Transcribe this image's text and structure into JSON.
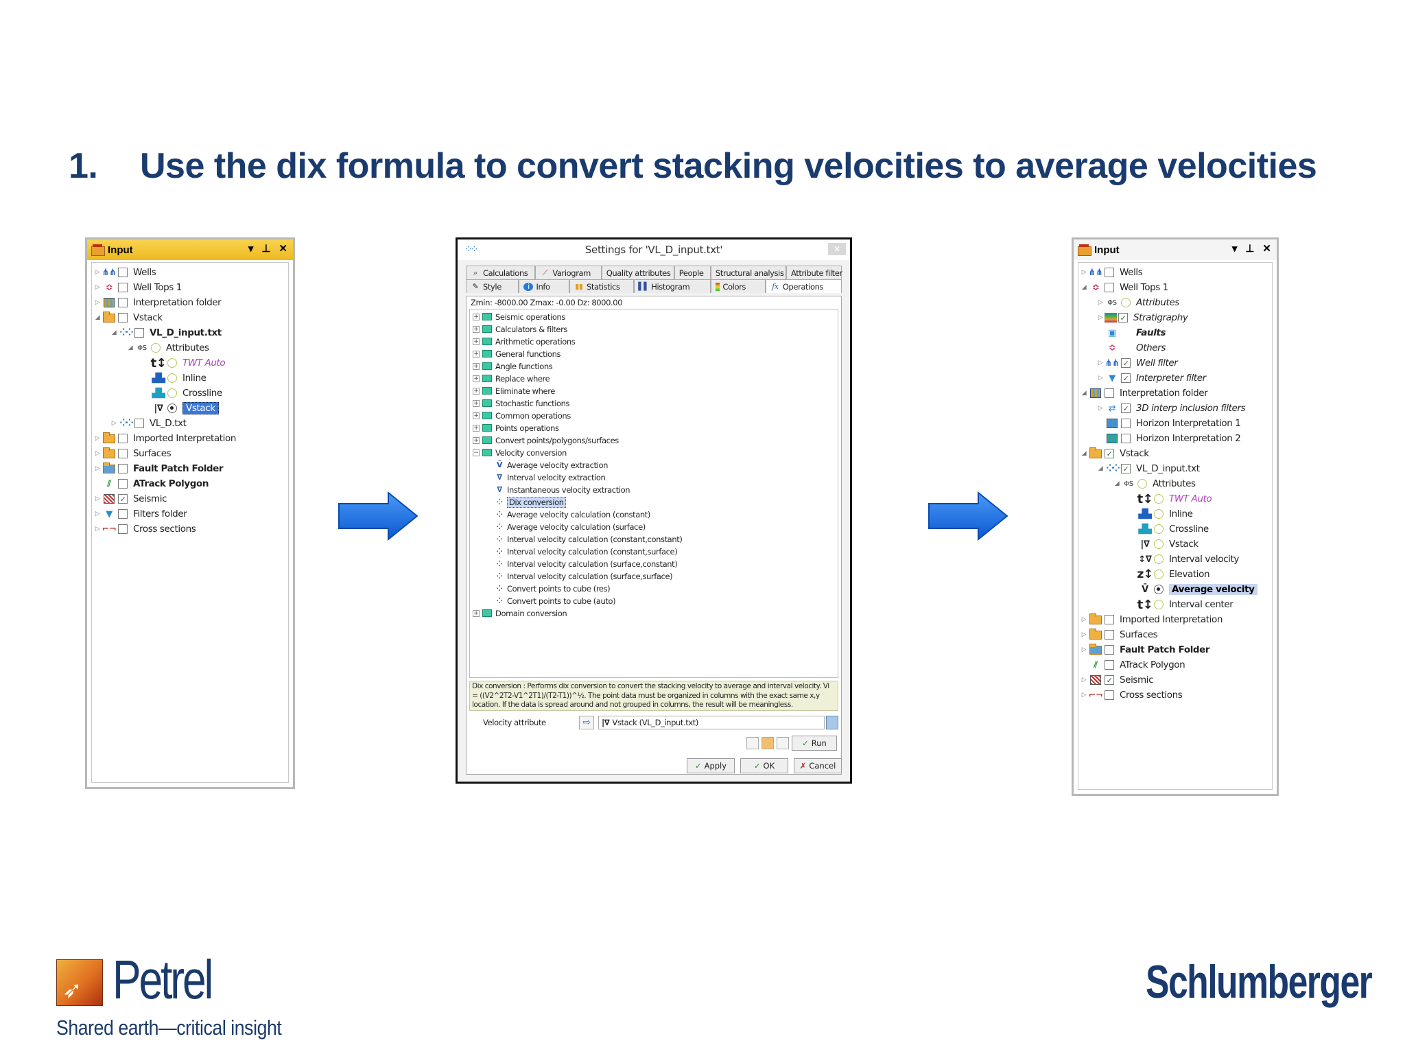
{
  "slide": {
    "number": "1.",
    "title": "Use the dix formula to convert stacking velocities to average velocities"
  },
  "left_panel": {
    "title": "Input",
    "controls": [
      "▾",
      "⊥",
      "✕"
    ],
    "items": [
      {
        "label": "Wells"
      },
      {
        "label": "Well Tops 1"
      },
      {
        "label": "Interpretation folder"
      },
      {
        "label": "Vstack"
      },
      {
        "label": "VL_D_input.txt"
      },
      {
        "label": "Attributes"
      },
      {
        "label": "TWT Auto"
      },
      {
        "label": "Inline"
      },
      {
        "label": "Crossline"
      },
      {
        "label": "Vstack"
      },
      {
        "label": "VL_D.txt"
      },
      {
        "label": "Imported Interpretation"
      },
      {
        "label": "Surfaces"
      },
      {
        "label": "Fault Patch Folder"
      },
      {
        "label": "ATrack Polygon"
      },
      {
        "label": "Seismic"
      },
      {
        "label": "Filters folder"
      },
      {
        "label": "Cross sections"
      }
    ]
  },
  "dialog": {
    "title": "Settings for 'VL_D_input.txt'",
    "close": "✕",
    "tabs_row1": [
      "Calculations",
      "Variogram",
      "Quality attributes",
      "People",
      "Structural analysis",
      "Attribute filter"
    ],
    "tabs_row2": [
      "Style",
      "Info",
      "Statistics",
      "Histogram",
      "Colors",
      "Operations"
    ],
    "zinfo": "Zmin:  -8000.00    Zmax:  -0.00    Dz:  8000.00",
    "operations": [
      "Seismic operations",
      "Calculators & filters",
      "Arithmetic operations",
      "General functions",
      "Angle functions",
      "Replace where",
      "Eliminate where",
      "Stochastic functions",
      "Common operations",
      "Points operations",
      "Convert points/polygons/surfaces",
      "Velocity conversion",
      "Average velocity extraction",
      "Interval velocity extraction",
      "Instantaneous velocity extraction",
      "Dix conversion",
      "Average velocity calculation (constant)",
      "Average velocity calculation (surface)",
      "Interval velocity calculation (constant,constant)",
      "Interval velocity calculation (constant,surface)",
      "Interval velocity calculation (surface,constant)",
      "Interval velocity calculation (surface,surface)",
      "Convert points to cube (res)",
      "Convert points to cube (auto)",
      "Domain conversion"
    ],
    "description": "Dix conversion : Performs dix conversion to convert the stacking velocity to average and interval velocity. Vi = ((V2^2T2-V1^2T1)/(T2-T1))^½. The point data must be organized in columns with the exact same x,y location. If the data is spread around and not grouped in columns, the result will be meaningless.",
    "velocity_label": "Velocity attribute",
    "velocity_value": "Vstack (VL_D_input.txt)",
    "run_label": "Run",
    "apply_label": "Apply",
    "ok_label": "OK",
    "cancel_label": "Cancel"
  },
  "right_panel": {
    "title": "Input",
    "controls": [
      "▾",
      "⊥",
      "✕"
    ],
    "items": [
      {
        "label": "Wells"
      },
      {
        "label": "Well Tops 1"
      },
      {
        "label": "Attributes"
      },
      {
        "label": "Stratigraphy"
      },
      {
        "label": "Faults"
      },
      {
        "label": "Others"
      },
      {
        "label": "Well filter"
      },
      {
        "label": "Interpreter filter"
      },
      {
        "label": "Interpretation folder"
      },
      {
        "label": "3D interp inclusion filters"
      },
      {
        "label": "Horizon Interpretation 1"
      },
      {
        "label": "Horizon Interpretation 2"
      },
      {
        "label": "Vstack"
      },
      {
        "label": "VL_D_input.txt"
      },
      {
        "label": "Attributes"
      },
      {
        "label": "TWT Auto"
      },
      {
        "label": "Inline"
      },
      {
        "label": "Crossline"
      },
      {
        "label": "Vstack"
      },
      {
        "label": "Interval velocity"
      },
      {
        "label": "Elevation"
      },
      {
        "label": "Average velocity"
      },
      {
        "label": "Interval center"
      },
      {
        "label": "Imported Interpretation"
      },
      {
        "label": "Surfaces"
      },
      {
        "label": "Fault Patch Folder"
      },
      {
        "label": "ATrack Polygon"
      },
      {
        "label": "Seismic"
      },
      {
        "label": "Cross sections"
      }
    ]
  },
  "logos": {
    "petrel_name": "Petrel",
    "petrel_tagline": "Shared earth—critical insight",
    "schlumberger": "Schlumberger"
  },
  "colors": {
    "title": "#1a3b6e",
    "arrow": "#1a6ee0",
    "panel_header": "#f2c230"
  }
}
